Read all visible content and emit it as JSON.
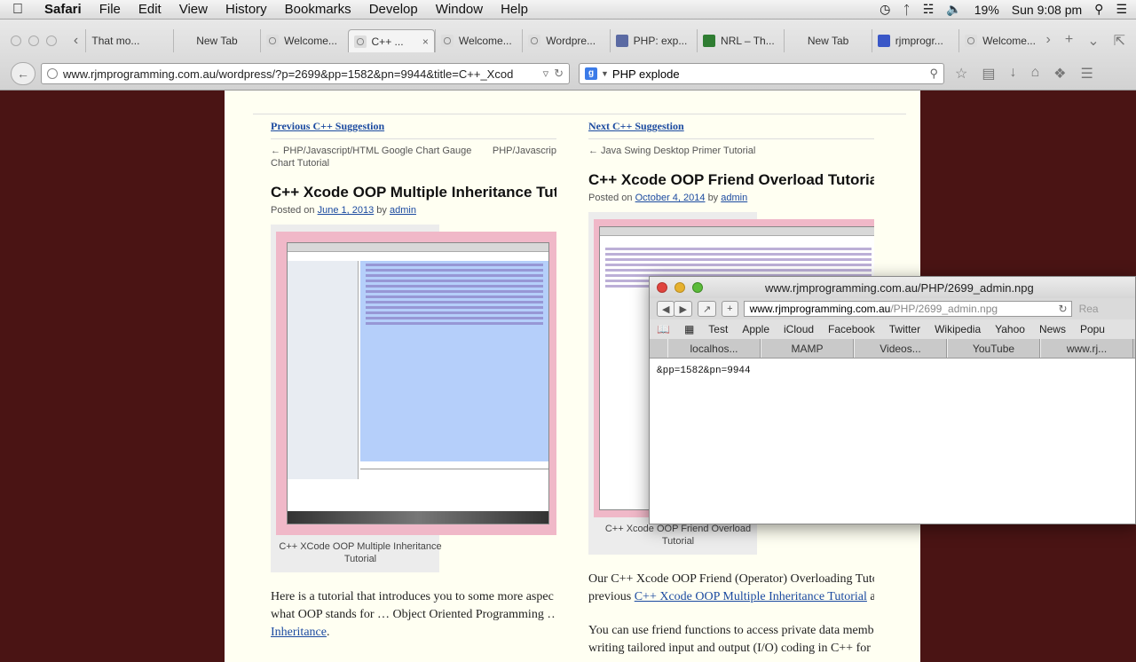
{
  "menubar": {
    "app": "Safari",
    "items": [
      "File",
      "Edit",
      "View",
      "History",
      "Bookmarks",
      "Develop",
      "Window",
      "Help"
    ],
    "battery": "19%",
    "clock": "Sun 9:08 pm"
  },
  "tabs": [
    {
      "label": "That mo..."
    },
    {
      "label": "New Tab"
    },
    {
      "label": "Welcome..."
    },
    {
      "label": "C++ ..."
    },
    {
      "label": "Welcome..."
    },
    {
      "label": "Wordpre..."
    },
    {
      "label": "PHP: exp..."
    },
    {
      "label": "NRL – Th..."
    },
    {
      "label": "New Tab"
    },
    {
      "label": "rjmprogr..."
    },
    {
      "label": "Welcome..."
    }
  ],
  "address": {
    "url": "www.rjmprogramming.com.au/wordpress/?p=2699&pp=1582&pn=9944&title=C++_Xcod",
    "search": "PHP explode"
  },
  "page": {
    "left": {
      "suggestion": "Previous C++ Suggestion",
      "nav_prev": "← PHP/Javascript/HTML Google Chart Gauge Chart Tutorial",
      "nav_next": "PHP/Javascrip",
      "title": "C++ Xcode OOP Multiple Inheritance Tut",
      "posted_prefix": "Posted on",
      "date": "June 1, 2013",
      "by": "by",
      "author": "admin",
      "caption": "C++ XCode OOP Multiple Inheritance Tutorial",
      "para1": "Here is a tutorial that introduces you to some more aspec",
      "para2": "what OOP stands for … Object Oriented Programming …",
      "para3": "Inheritance",
      "para3_suffix": "."
    },
    "right": {
      "suggestion": "Next C++ Suggestion",
      "nav_prev": "← Java Swing Desktop Primer Tutorial",
      "title": "C++ Xcode OOP Friend Overload Tutoria",
      "posted_prefix": "Posted on",
      "date": "October 4, 2014",
      "by": "by",
      "author": "admin",
      "caption": "C++ Xcode OOP Friend Overload Tutorial",
      "para1": "Our C++ Xcode OOP Friend (Operator) Overloading Tuto",
      "para2_prefix": "previous",
      "para2_link": "C++ Xcode OOP Multiple Inheritance Tutorial",
      "para2_suffix": " a",
      "para3": "You can use friend functions to access private data memb",
      "para4": "writing tailored input and output (I/O) coding in C++ for"
    }
  },
  "popup": {
    "title": "www.rjmprogramming.com.au/PHP/2699_admin.npg",
    "url_host": "www.rjmprogramming.com.au",
    "url_path": "/PHP/2699_admin.npg",
    "reader": "Rea",
    "favorites": [
      "Test",
      "Apple",
      "iCloud",
      "Facebook",
      "Twitter",
      "Wikipedia",
      "Yahoo",
      "News",
      "Popu"
    ],
    "tabs": [
      "localhos...",
      "MAMP",
      "Videos...",
      "YouTube",
      "www.rj..."
    ],
    "content": "&pp=1582&pn=9944"
  }
}
